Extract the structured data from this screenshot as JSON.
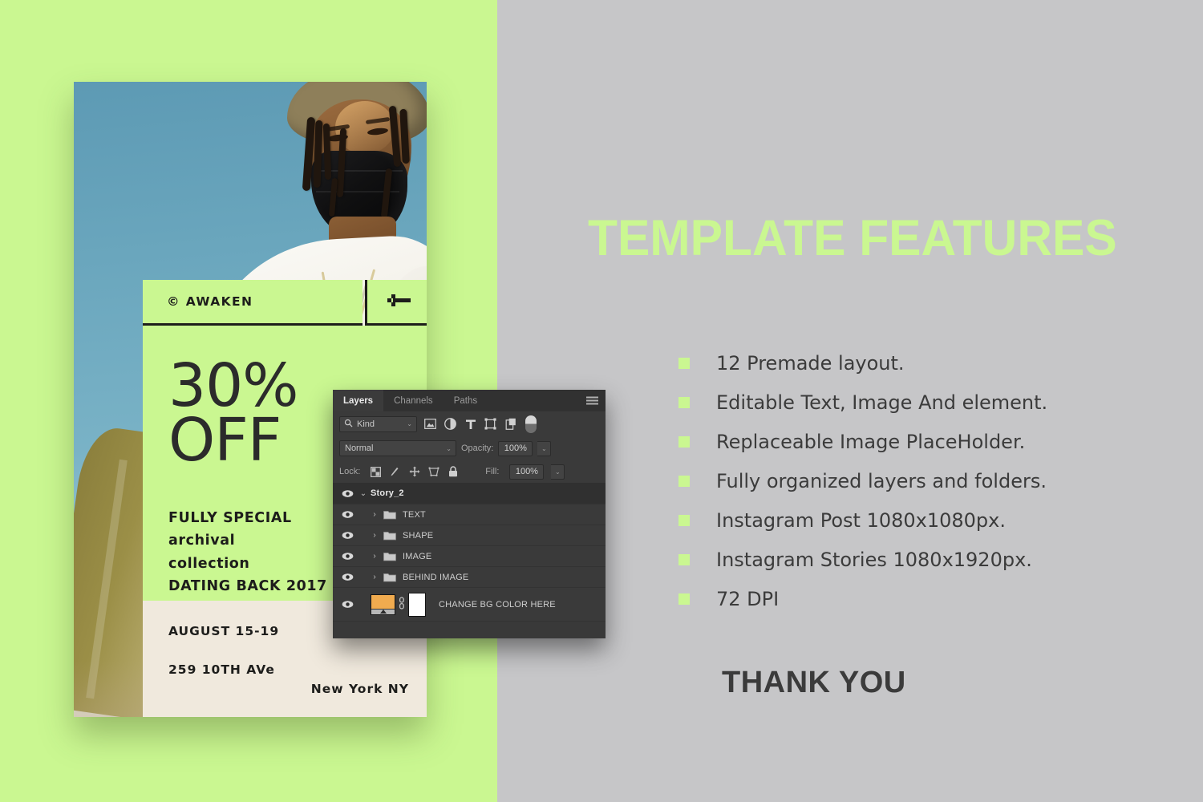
{
  "colors": {
    "green_accent": "#CAF791",
    "grey_bg": "#C6C6C8",
    "cream": "#F0E9DD",
    "dark_text": "#1D1D1B",
    "panel_bg": "#393939",
    "thumb_orange": "#F0AB4F"
  },
  "poster": {
    "brand_name": "© AWAKEN",
    "arrow_icon": "arrow-left-icon",
    "discount": "30%\nOFF",
    "discount_line1": "30%",
    "discount_line2": "OFF",
    "copy_line1": "FULLY SPECIAL",
    "copy_line2": "archival",
    "copy_line3": "collection",
    "copy_line4": "DATING BACK 2017",
    "date": "AUGUST 15-19",
    "address_line1": "259 10TH AVe",
    "address_line2": "New York NY"
  },
  "photoshop_panel": {
    "tabs": [
      {
        "label": "Layers",
        "active": true
      },
      {
        "label": "Channels",
        "active": false
      },
      {
        "label": "Paths",
        "active": false
      }
    ],
    "menu_icon": "hamburger-menu-icon",
    "filter_row": {
      "search_icon": "search-icon",
      "kind_value": "Kind",
      "chevron": "⌄",
      "icons": [
        "pixel-layer-filter-icon",
        "adjustment-layer-filter-icon",
        "type-layer-filter-icon",
        "shape-layer-filter-icon",
        "smart-object-filter-icon",
        "filter-toggle-switch"
      ]
    },
    "blend_row": {
      "blend_mode": "Normal",
      "opacity_label": "Opacity:",
      "opacity_value": "100%",
      "chevron": "⌄"
    },
    "lock_row": {
      "lock_label": "Lock:",
      "icons": [
        "lock-transparent-pixels-icon",
        "lock-image-pixels-icon",
        "lock-position-icon",
        "lock-artboard-nesting-icon",
        "lock-all-icon"
      ],
      "fill_label": "Fill:",
      "fill_value": "100%"
    },
    "layers": [
      {
        "name": "Story_2",
        "type": "group-head",
        "expanded": true,
        "visible": true
      },
      {
        "name": "TEXT",
        "type": "folder",
        "expanded": false,
        "visible": true
      },
      {
        "name": "SHAPE",
        "type": "folder",
        "expanded": false,
        "visible": true
      },
      {
        "name": "IMAGE",
        "type": "folder",
        "expanded": false,
        "visible": true
      },
      {
        "name": "BEHIND IMAGE",
        "type": "folder",
        "expanded": false,
        "visible": true
      },
      {
        "name": "CHANGE BG COLOR HERE",
        "type": "fill-layer",
        "visible": true,
        "link_icon": "link-icon"
      }
    ]
  },
  "right": {
    "title": "TEMPLATE FEATURES",
    "features": [
      "12 Premade layout.",
      "Editable Text, Image And element.",
      "Replaceable Image PlaceHolder.",
      "Fully organized layers and folders.",
      "Instagram Post 1080x1080px.",
      "Instagram Stories 1080x1920px.",
      "72 DPI"
    ],
    "thank_you": "THANK YOU"
  }
}
